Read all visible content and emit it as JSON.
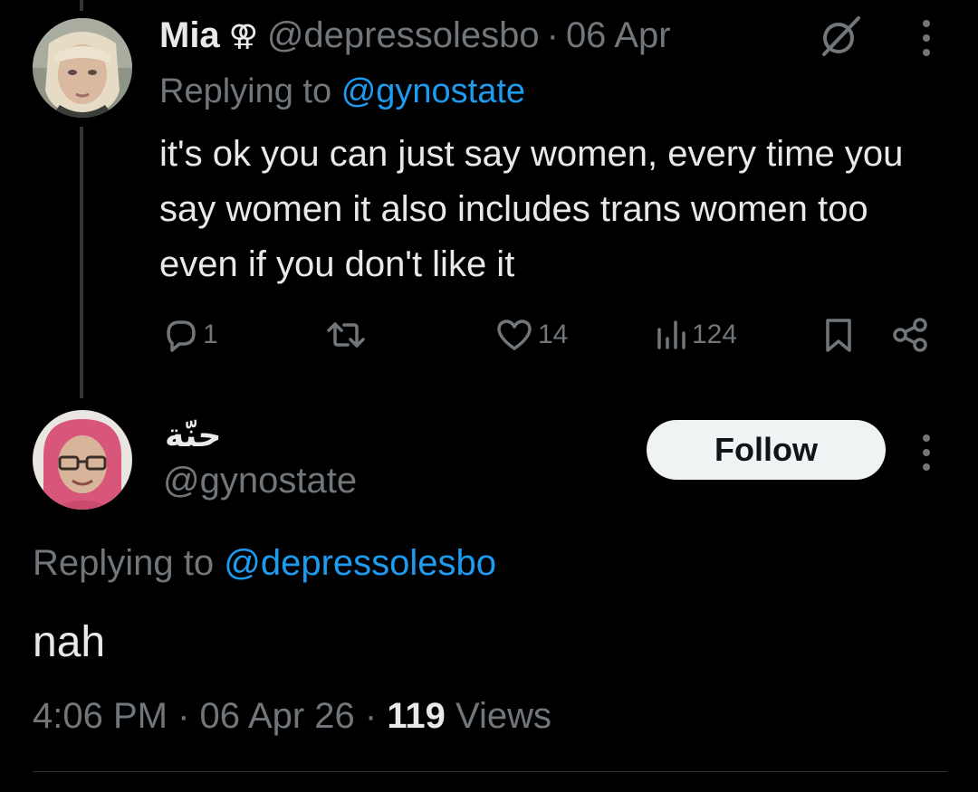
{
  "reply_tweet": {
    "author_name": "Mia",
    "author_symbol": "⚢",
    "author_handle": "@depressolesbo",
    "separator": "·",
    "date": "06 Apr",
    "replying_prefix": "Replying to",
    "replying_to": "@gynostate",
    "text": "it's ok you can just say women, every time you say women it also includes trans women too even if you don't like it",
    "actions": {
      "reply_count": "1",
      "retweet_count": "",
      "like_count": "14",
      "view_count": "124"
    },
    "icons": [
      "grok-icon",
      "more-icon",
      "reply-icon",
      "retweet-icon",
      "heart-icon",
      "views-icon",
      "bookmark-icon",
      "share-icon"
    ]
  },
  "main_tweet": {
    "author_name": "حنّة",
    "author_handle": "@gynostate",
    "follow_label": "Follow",
    "replying_prefix": "Replying to",
    "replying_to": "@depressolesbo",
    "text": "nah",
    "time": "4:06 PM",
    "separator": "·",
    "date": "06 Apr 26",
    "views_count": "119",
    "views_label": "Views"
  },
  "colors": {
    "background": "#000000",
    "primary_text": "#e7e9ea",
    "secondary_text": "#71767b",
    "link": "#1d9bf0",
    "follow_button_bg": "#eff3f4",
    "follow_button_text": "#0f1419"
  }
}
